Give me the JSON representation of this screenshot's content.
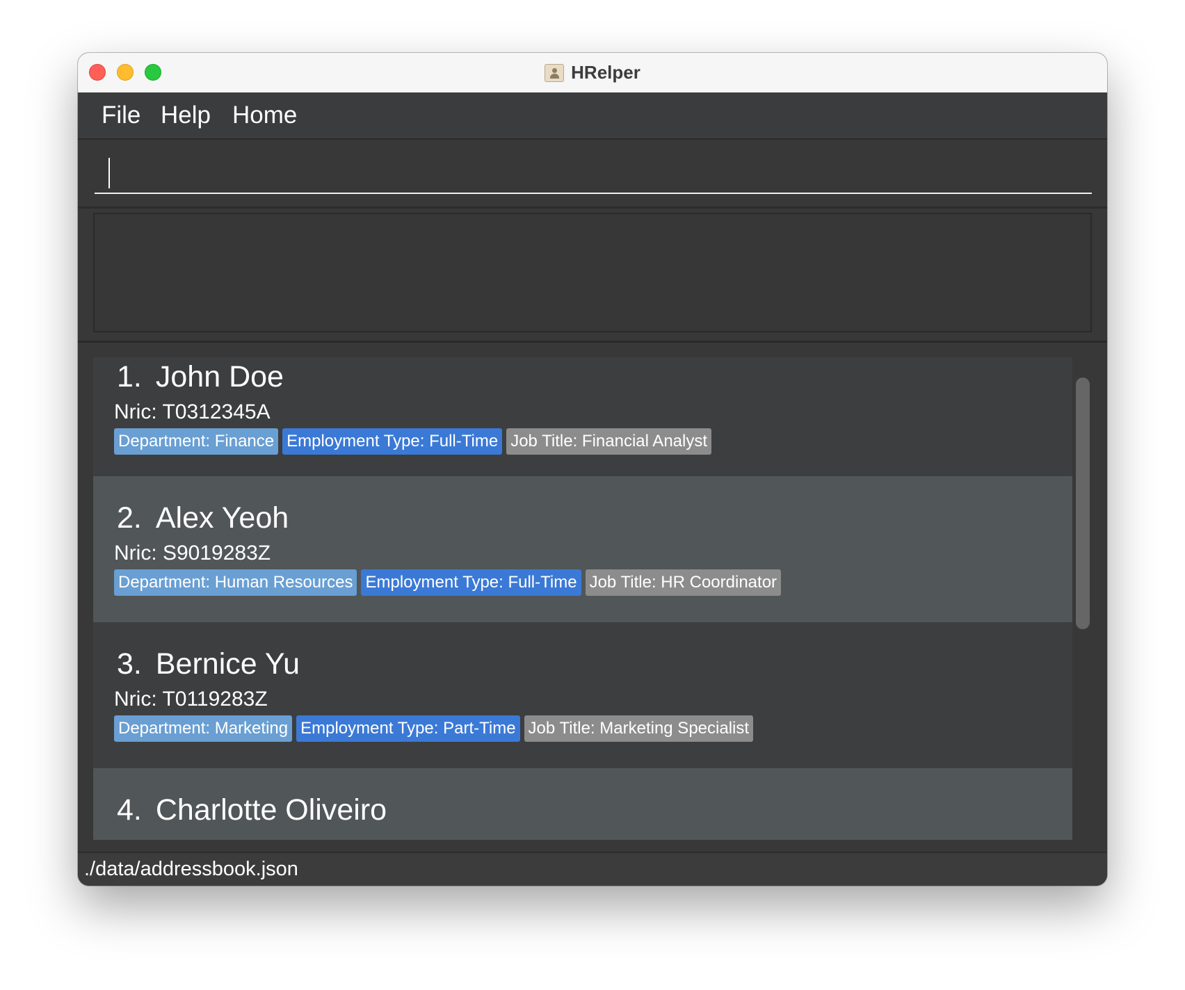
{
  "window": {
    "title": "HRelper"
  },
  "menu": {
    "items": [
      "File",
      "Help",
      "Home"
    ]
  },
  "command": {
    "value": "",
    "placeholder": ""
  },
  "result": {
    "text": ""
  },
  "persons": [
    {
      "index": "1.",
      "name": "John Doe",
      "nric": "Nric: T0312345A",
      "department": "Department: Finance",
      "employment_type": "Employment Type: Full-Time",
      "job_title": "Job Title: Financial Analyst"
    },
    {
      "index": "2.",
      "name": "Alex Yeoh",
      "nric": "Nric: S9019283Z",
      "department": "Department: Human Resources",
      "employment_type": "Employment Type: Full-Time",
      "job_title": "Job Title: HR Coordinator"
    },
    {
      "index": "3.",
      "name": "Bernice Yu",
      "nric": "Nric: T0119283Z",
      "department": "Department: Marketing",
      "employment_type": "Employment Type: Part-Time",
      "job_title": "Job Title: Marketing Specialist"
    },
    {
      "index": "4.",
      "name": "Charlotte Oliveiro"
    }
  ],
  "status": {
    "file_path": "./data/addressbook.json"
  },
  "colors": {
    "department_tag": "#699fd3",
    "employment_tag": "#3b79d6",
    "job_tag": "#8c8c8c",
    "card_odd": "#3c3e3f",
    "card_even": "#515658"
  }
}
